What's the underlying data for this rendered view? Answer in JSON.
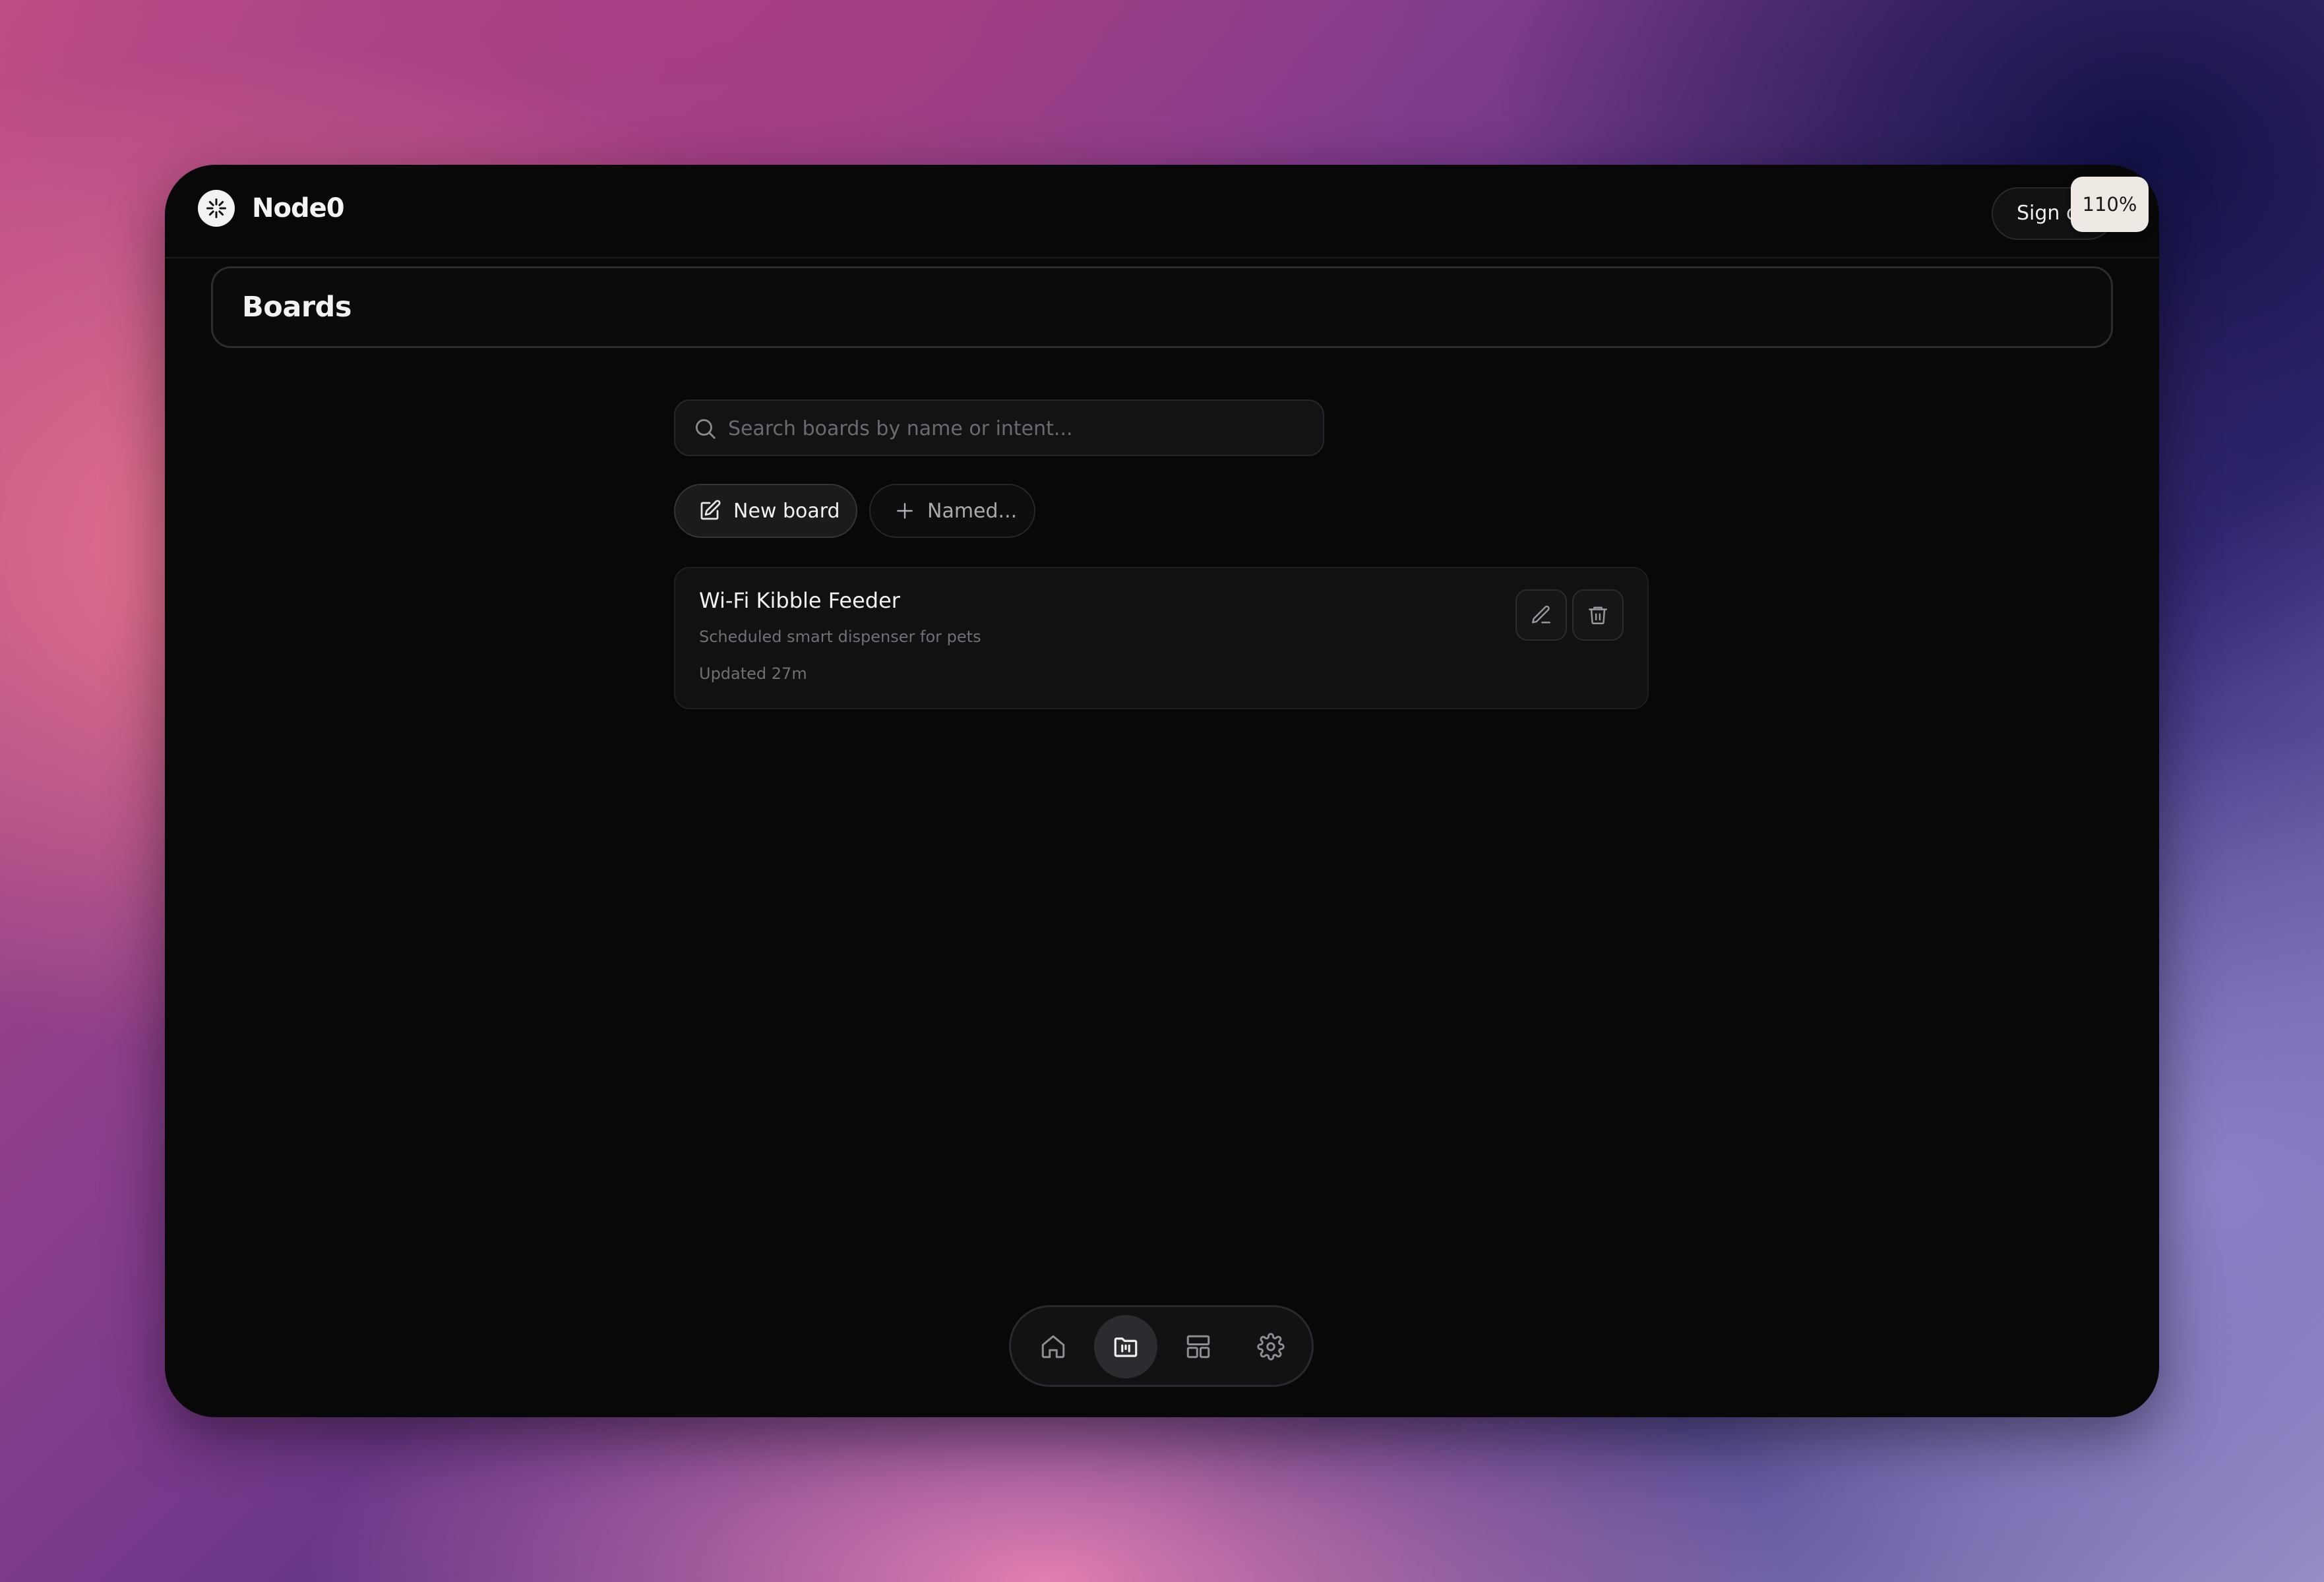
{
  "app": {
    "name": "Node0"
  },
  "topbar": {
    "sign_out_label": "Sign out",
    "zoom_level": "110%"
  },
  "page": {
    "title": "Boards"
  },
  "search": {
    "placeholder": "Search boards by name or intent..."
  },
  "actions": {
    "new_board_label": "New board",
    "named_label": "Named..."
  },
  "boards": [
    {
      "title": "Wi-Fi Kibble Feeder",
      "description": "Scheduled smart dispenser for pets",
      "updated": "Updated 27m"
    }
  ],
  "dock": {
    "items": [
      {
        "icon": "home-icon",
        "active": false
      },
      {
        "icon": "boards-folder-icon",
        "active": true
      },
      {
        "icon": "layout-icon",
        "active": false
      },
      {
        "icon": "gear-icon",
        "active": false
      }
    ]
  },
  "colors": {
    "background": "#080809",
    "text": "#f2f2f2",
    "muted": "#6f6f75",
    "zoom_badge": "#efe9e4"
  }
}
